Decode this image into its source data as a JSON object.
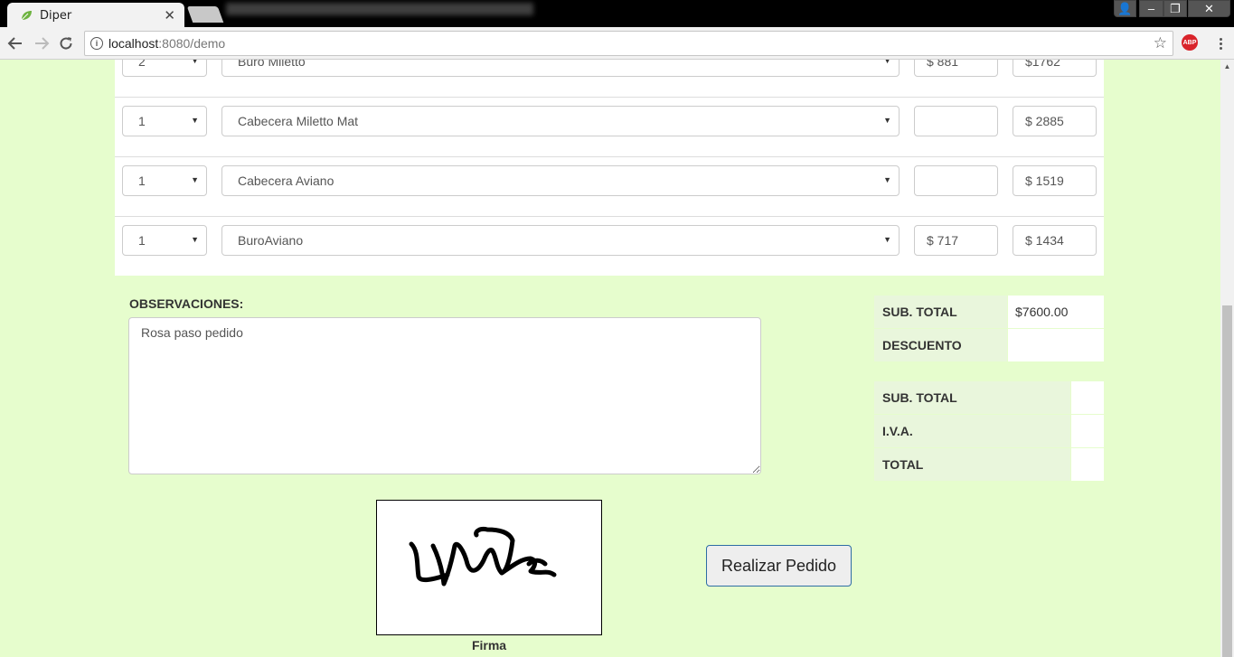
{
  "browser": {
    "tab_title": "Diper",
    "tab_close": "✕",
    "url_host": "localhost",
    "url_rest": ":8080/demo",
    "window_controls": {
      "user": "👤",
      "minimize": "–",
      "maximize": "❐",
      "close": "✕"
    },
    "adblock_label": "ABP"
  },
  "products": [
    {
      "quantity": "2",
      "name": "Buro Miletto",
      "unit_price": "$ 881",
      "total": "$1762"
    },
    {
      "quantity": "1",
      "name": "Cabecera Miletto Mat",
      "unit_price": "",
      "total": "$ 2885"
    },
    {
      "quantity": "1",
      "name": "Cabecera Aviano",
      "unit_price": "",
      "total": "$ 1519"
    },
    {
      "quantity": "1",
      "name": "BuroAviano",
      "unit_price": "$ 717",
      "total": "$ 1434"
    }
  ],
  "observations": {
    "label": "OBSERVACIONES:",
    "value": "Rosa paso pedido"
  },
  "summary_top": {
    "subtotal_label": "SUB. TOTAL",
    "subtotal_value": "$7600.00",
    "discount_label": "DESCUENTO",
    "discount_value": ""
  },
  "summary_bottom": {
    "subtotal_label": "SUB. TOTAL",
    "subtotal_value": "",
    "iva_label": "I.V.A.",
    "iva_value": "",
    "total_label": "TOTAL",
    "total_value": ""
  },
  "signature": {
    "caption": "Firma"
  },
  "actions": {
    "submit_label": "Realizar Pedido"
  },
  "colors": {
    "page_background": "#e6fdcd",
    "summary_label_bg": "#e9f6dc",
    "button_border": "#2e6da4"
  }
}
